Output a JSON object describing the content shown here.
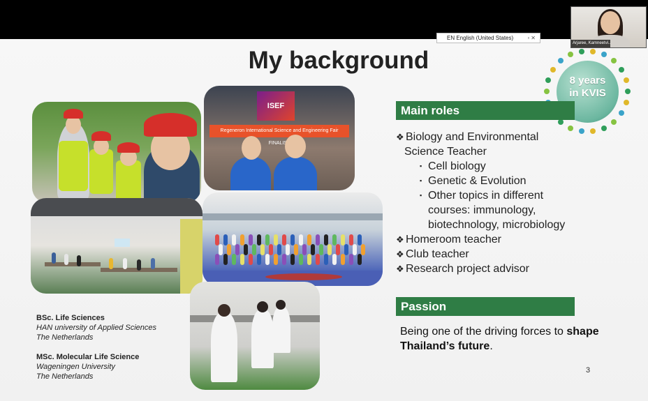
{
  "slide": {
    "title": "My background",
    "page_number": "3"
  },
  "caption_bar": {
    "language": "EN English (United States)"
  },
  "webcam": {
    "name": "Arjaree, Kamneetvi..."
  },
  "badge": {
    "line1": "8 years",
    "line2": "in KVIS"
  },
  "photos": {
    "isef_label": "ISEF",
    "banner_text": "Regeneron International Science and Engineering Fair FINALIST"
  },
  "main_roles": {
    "header": "Main roles",
    "items": [
      {
        "marker": "❖",
        "text": "Biology and Environmental",
        "cont": "Science Teacher"
      },
      {
        "marker": "▪",
        "text": "Cell biology",
        "level": 2
      },
      {
        "marker": "▪",
        "text": "Genetic & Evolution",
        "level": 2
      },
      {
        "marker": "▪",
        "text": "Other topics in different",
        "level": 2,
        "cont": "courses: immunology,",
        "cont2": "biotechnology, microbiology"
      },
      {
        "marker": "❖",
        "text": "Homeroom teacher"
      },
      {
        "marker": "❖",
        "text": "Club teacher"
      },
      {
        "marker": "❖",
        "text": "Research project advisor"
      }
    ]
  },
  "passion": {
    "header": "Passion",
    "text_before": "Being one of the driving forces to ",
    "text_bold": "shape Thailand’s future",
    "text_after": "."
  },
  "education": [
    {
      "degree": "BSc. Life Sciences",
      "school": "HAN university of Applied Sciences",
      "country": "The Netherlands"
    },
    {
      "degree": "MSc. Molecular Life Science",
      "school": "Wageningen University",
      "country": "The Netherlands"
    }
  ],
  "colors": {
    "header_green": "#2f7d45",
    "helmet_red": "#d62f2a",
    "vest_yellow": "#c6e02b"
  }
}
